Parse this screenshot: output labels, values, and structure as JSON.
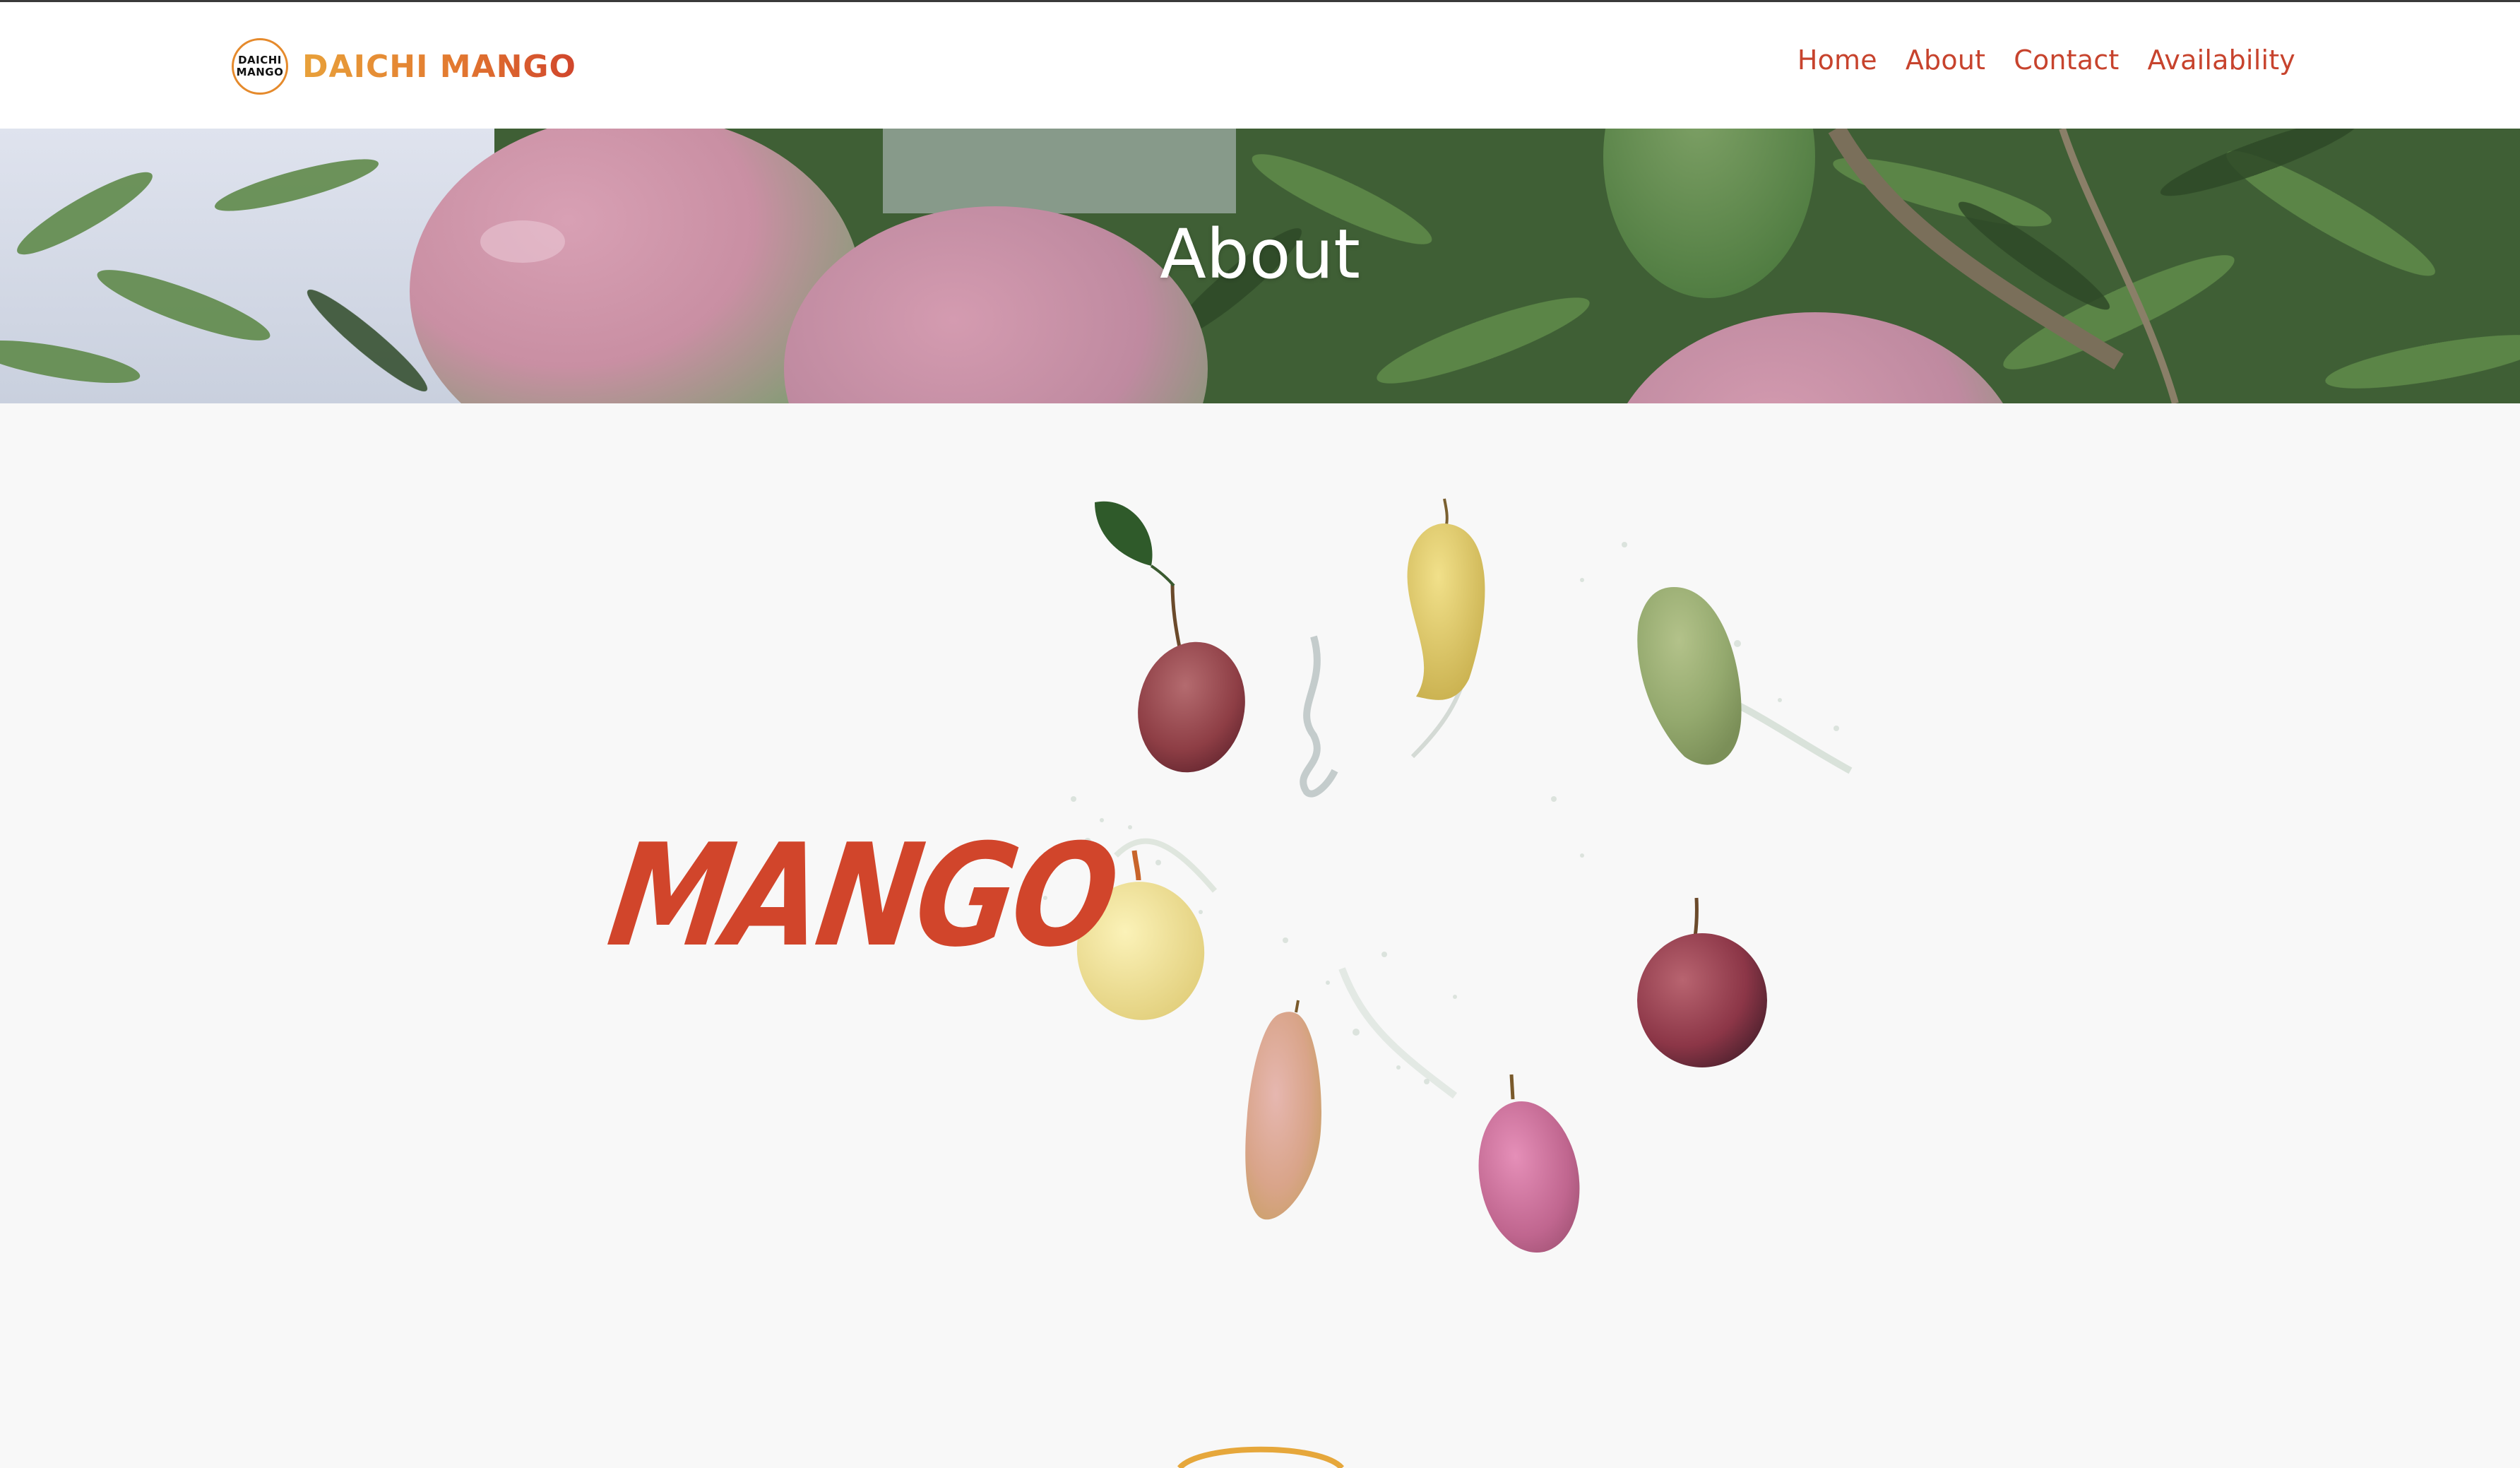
{
  "site": {
    "logo_badge_line1": "DAICHI",
    "logo_badge_line2": "MANGO",
    "logo_text": "DAICHI MANGO"
  },
  "nav": {
    "items": [
      {
        "label": "Home"
      },
      {
        "label": "About"
      },
      {
        "label": "Contact"
      },
      {
        "label": "Availability"
      }
    ]
  },
  "hero": {
    "title": "About"
  },
  "main": {
    "headline": "MANGO"
  },
  "colors": {
    "nav_text": "#c7432d",
    "headline": "#d1452b",
    "logo_gradient_start": "#e8a13a",
    "logo_gradient_end": "#d0452c",
    "page_background": "#f8f8f8",
    "ring_accent": "#e6a73b"
  }
}
